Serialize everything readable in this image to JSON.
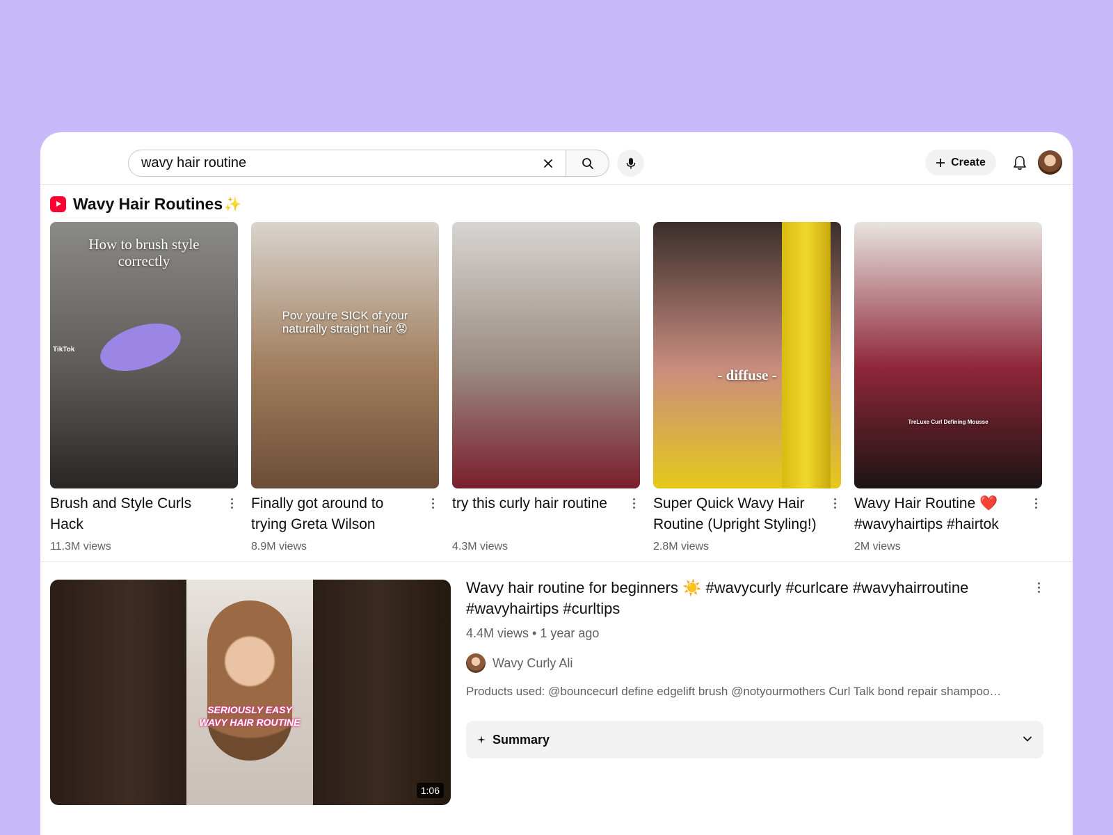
{
  "search": {
    "query": "wavy hair routine",
    "clear_icon": "close-icon",
    "search_icon": "search-icon",
    "mic_icon": "microphone-icon"
  },
  "header": {
    "create_label": "Create",
    "bell_icon": "bell-icon"
  },
  "shorts": {
    "title": "Wavy Hair Routines",
    "sparkle": "✨",
    "items": [
      {
        "title": "Brush and Style Curls Hack",
        "views": "11.3M views",
        "caption": "How to brush style correctly",
        "watermark": "TikTok",
        "colors": [
          "#8a8a86",
          "#5e5b58",
          "#2a2624"
        ]
      },
      {
        "title": "Finally got around to trying Greta Wilson wav…",
        "views": "8.9M views",
        "caption": "Pov you're SICK of your naturally straight hair 😡",
        "colors": [
          "#d9d4cd",
          "#a07e5e",
          "#6b4d37"
        ]
      },
      {
        "title": "try this curly hair routine",
        "views": "4.3M views",
        "caption": "",
        "colors": [
          "#d7d5d2",
          "#9a8b80",
          "#7a1e2c"
        ]
      },
      {
        "title": "Super Quick Wavy Hair Routine (Upright Styling!)",
        "views": "2.8M views",
        "caption": "- diffuse -",
        "colors": [
          "#3a2e2a",
          "#c98d7f",
          "#e6c91a"
        ]
      },
      {
        "title": "Wavy Hair Routine ❤️ #wavyhairtips #hairtok",
        "views": "2M views",
        "caption": "TreLuxe Curl Defining Mousse",
        "colors": [
          "#e8e4e0",
          "#8e2638",
          "#1c1414"
        ]
      }
    ]
  },
  "video": {
    "title": "Wavy hair routine for beginners ☀️  #wavycurly #curlcare #wavyhairroutine #wavyhairtips #curltips",
    "meta": "4.4M views • 1 year ago",
    "channel": "Wavy Curly Ali",
    "description": "Products used: @bouncecurl define edgelift brush @notyourmothers Curl Talk bond repair shampoo…",
    "duration": "1:06",
    "thumb_caption_line1": "SERIOUSLY EASY",
    "thumb_caption_line2": "WAVY HAIR ROUTINE",
    "summary_label": "Summary"
  }
}
